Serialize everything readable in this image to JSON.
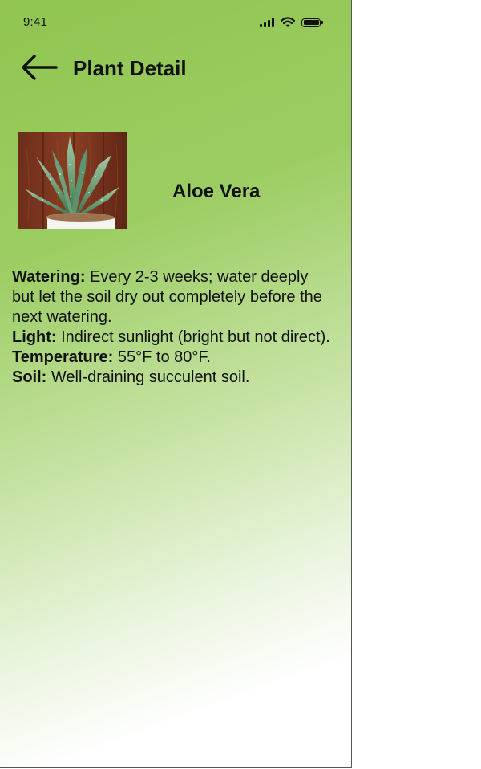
{
  "status_bar": {
    "time": "9:41",
    "icons": [
      "signal-icon",
      "wifi-icon",
      "battery-icon"
    ]
  },
  "header": {
    "title": "Plant Detail",
    "back_icon": "arrow-left-icon"
  },
  "plant": {
    "name": "Aloe Vera",
    "image_icon": "aloe-vera-photo"
  },
  "care": {
    "watering": {
      "label": "Watering:",
      "text": "Every 2-3 weeks; water deeply but let the soil dry out completely before the next watering."
    },
    "light": {
      "label": "Light:",
      "text": "Indirect sunlight (bright but not direct)."
    },
    "temperature": {
      "label": "Temperature:",
      "text": "55°F to 80°F."
    },
    "soil": {
      "label": "Soil:",
      "text": "Well-draining succulent soil."
    }
  },
  "colors": {
    "gradient_start": "#8fc550",
    "gradient_end": "#ffffff",
    "text": "#111111"
  }
}
